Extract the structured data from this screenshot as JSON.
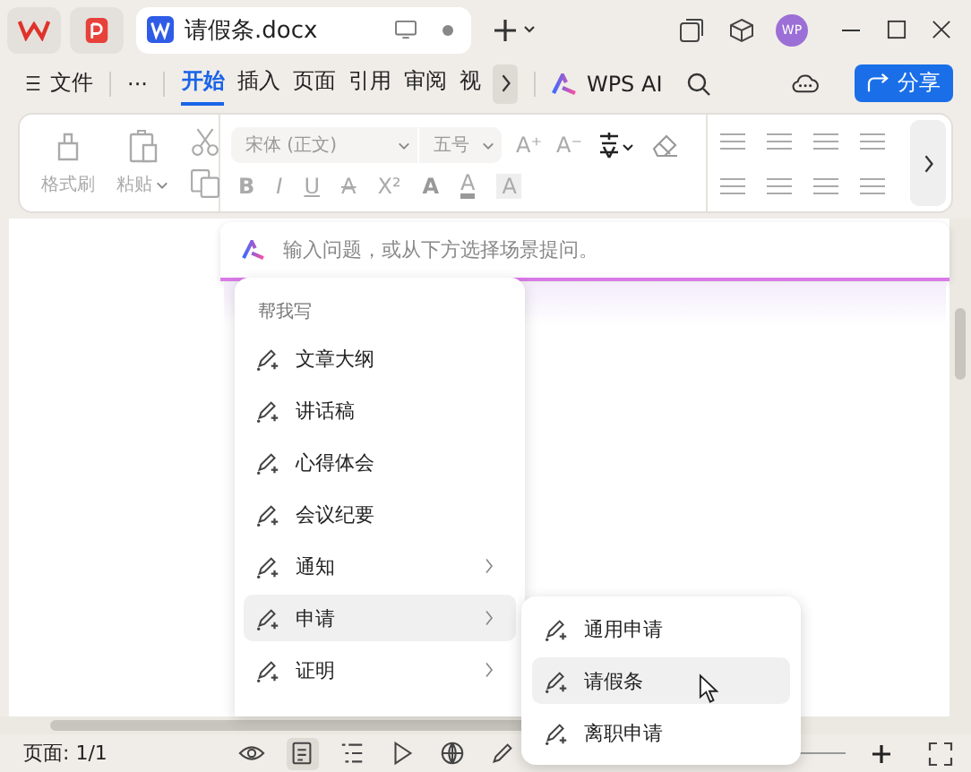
{
  "document_tab": {
    "title": "请假条.docx"
  },
  "avatar": "WP",
  "menu_bar": {
    "file": "文件",
    "more": "···",
    "tabs": [
      {
        "label": "开始",
        "selected": true
      },
      {
        "label": "插入",
        "selected": false
      },
      {
        "label": "页面",
        "selected": false
      },
      {
        "label": "引用",
        "selected": false
      },
      {
        "label": "审阅",
        "selected": false
      },
      {
        "label": "视",
        "selected": false
      }
    ],
    "ai": "WPS AI",
    "share": "分享"
  },
  "ribbon": {
    "format_painter": "格式刷",
    "paste": "粘贴",
    "font": "宋体 (正文)",
    "font_size": "五号",
    "row1_glyphs": [
      "A⁺",
      "A⁻"
    ],
    "row2_glyphs": [
      {
        "glyph": "B",
        "kind": "bold"
      },
      {
        "glyph": "I",
        "kind": "italic"
      },
      {
        "glyph": "U",
        "kind": "underline"
      },
      {
        "glyph": "A",
        "kind": "strike"
      },
      {
        "glyph": "X²",
        "kind": "plain"
      },
      {
        "glyph": "A",
        "kind": "outline"
      },
      {
        "glyph": "A",
        "kind": "color"
      },
      {
        "glyph": "A",
        "kind": "shade"
      }
    ]
  },
  "ai_prompt": {
    "placeholder": "输入问题，或从下方选择场景提问。"
  },
  "write_menu": {
    "heading": "帮我写",
    "items": [
      {
        "label": "文章大纲",
        "submenu": false,
        "selected": false
      },
      {
        "label": "讲话稿",
        "submenu": false,
        "selected": false
      },
      {
        "label": "心得体会",
        "submenu": false,
        "selected": false
      },
      {
        "label": "会议纪要",
        "submenu": false,
        "selected": false
      },
      {
        "label": "通知",
        "submenu": true,
        "selected": false
      },
      {
        "label": "申请",
        "submenu": true,
        "selected": true
      },
      {
        "label": "证明",
        "submenu": true,
        "selected": false
      }
    ]
  },
  "submenu": {
    "items": [
      {
        "label": "通用申请",
        "selected": false
      },
      {
        "label": "请假条",
        "selected": true
      },
      {
        "label": "离职申请",
        "selected": false
      }
    ]
  },
  "status_bar": {
    "page": "页面: 1/1",
    "views": [
      {
        "kind": "eye",
        "selected": false
      },
      {
        "kind": "page",
        "selected": true
      },
      {
        "kind": "outline",
        "selected": false
      },
      {
        "kind": "play",
        "selected": false
      },
      {
        "kind": "web",
        "selected": false
      },
      {
        "kind": "pen",
        "selected": false
      }
    ]
  }
}
